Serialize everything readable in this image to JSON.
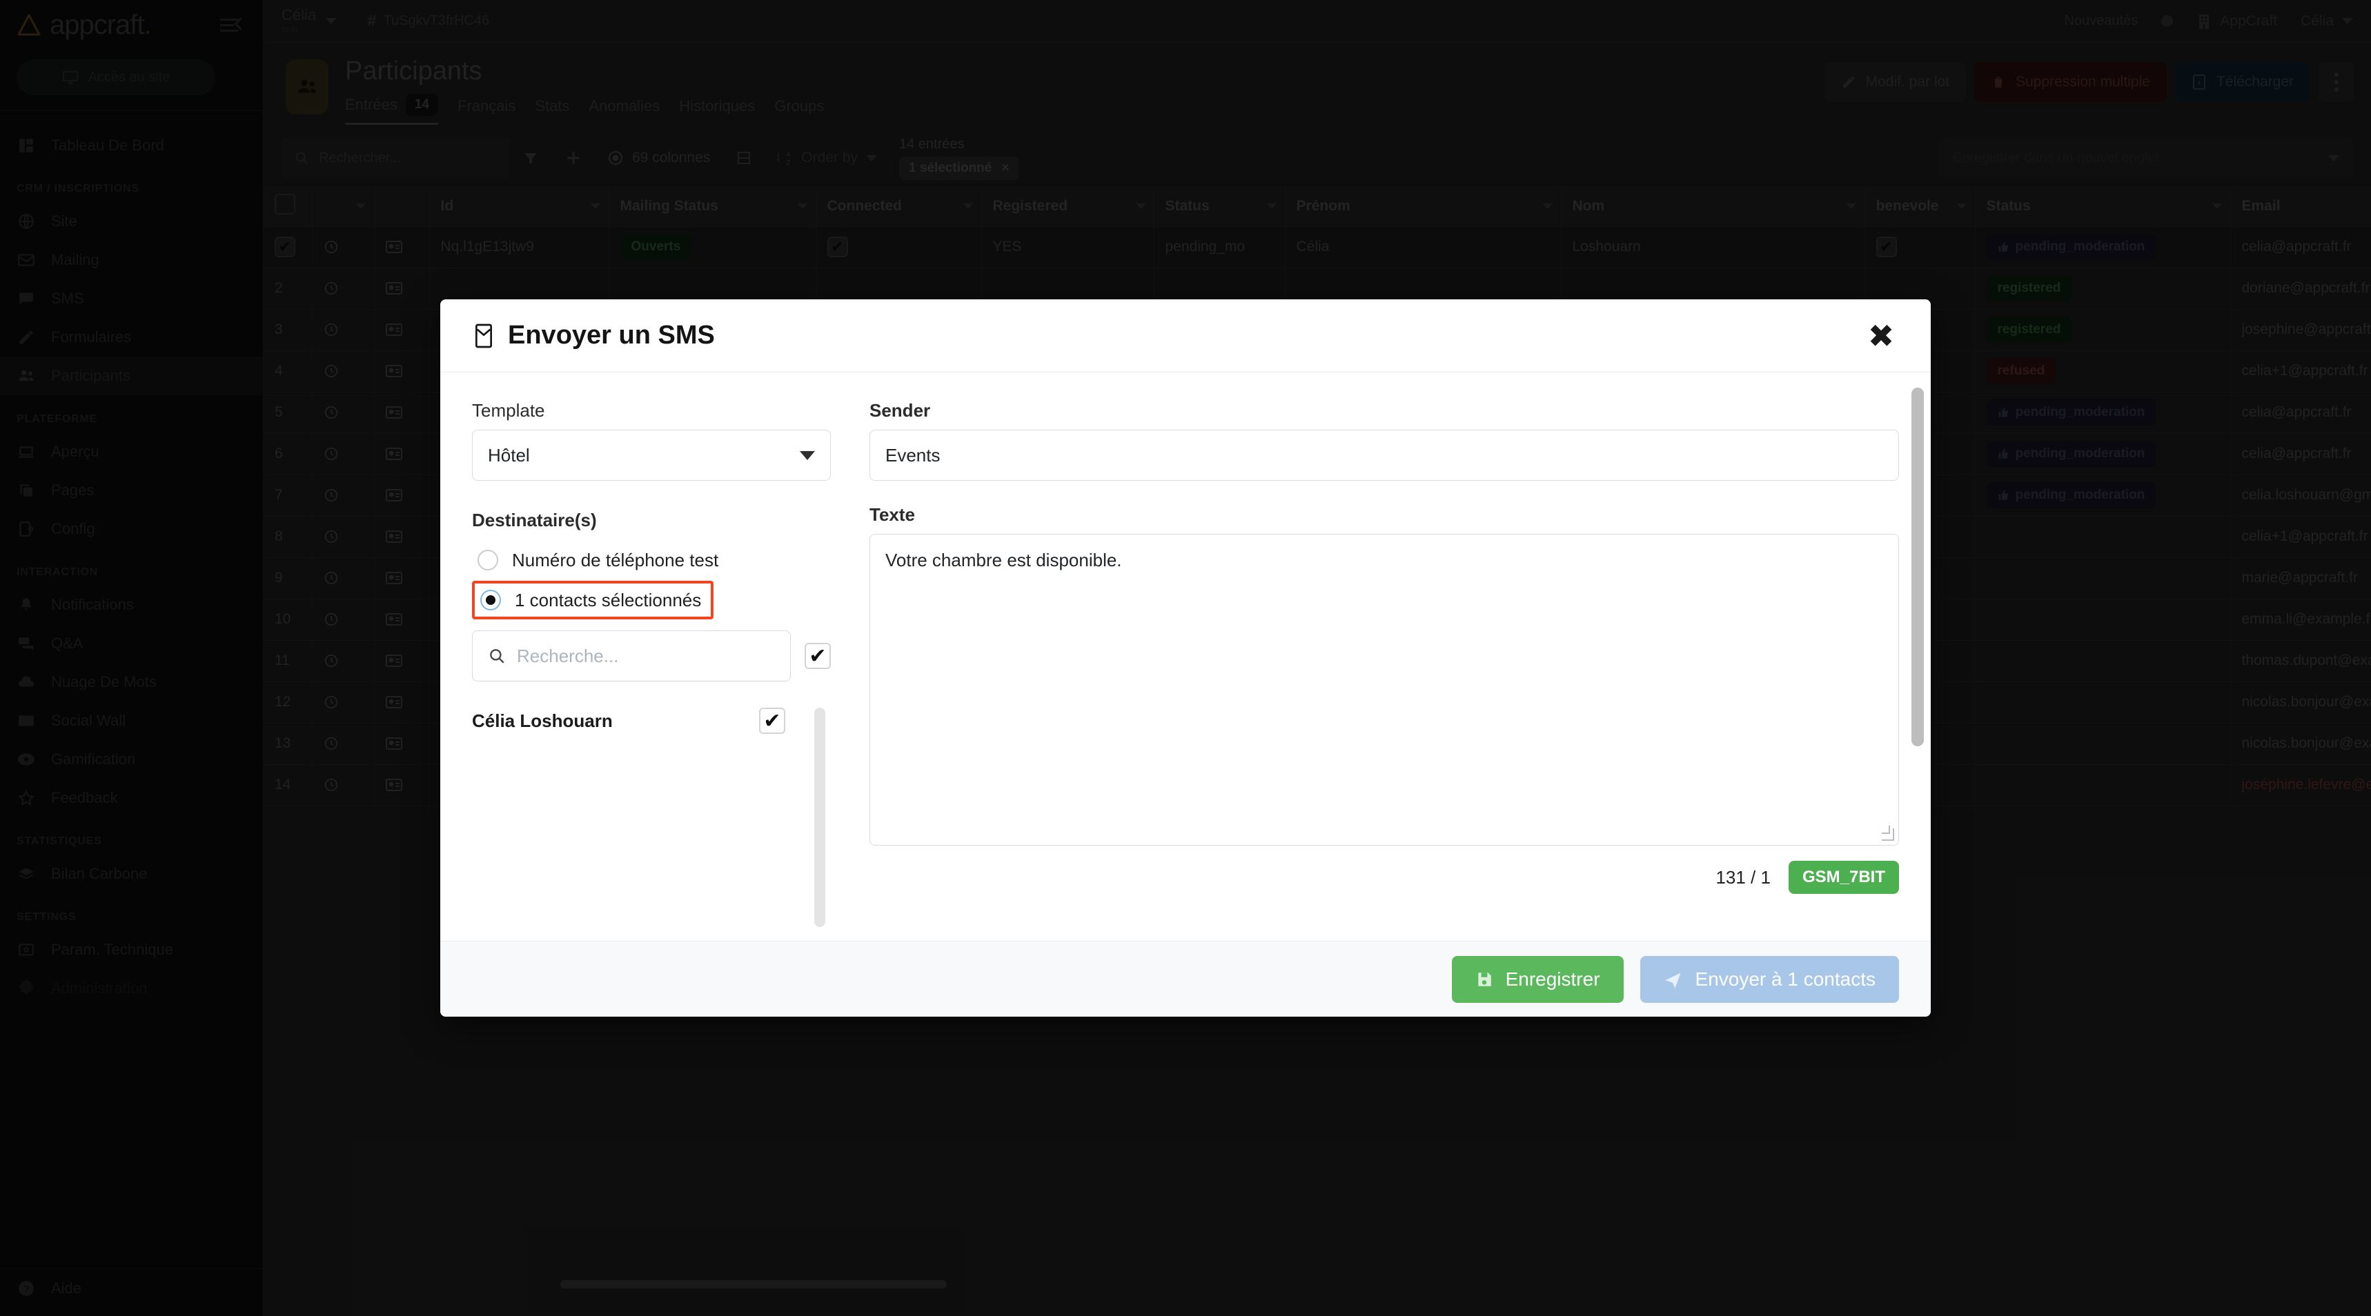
{
  "sidebar": {
    "brand": {
      "text": "appcraft",
      "dot": "."
    },
    "access_button": {
      "label": "Accès au site",
      "icon": "monitor-icon"
    },
    "sections": [
      {
        "title": "",
        "items": [
          {
            "label": "Tableau De Bord",
            "icon": "dashboard-icon",
            "active": false
          }
        ]
      },
      {
        "title": "CRM / INSCRIPTIONS",
        "items": [
          {
            "label": "Site",
            "icon": "globe-icon",
            "active": false
          },
          {
            "label": "Mailing",
            "icon": "envelope-icon",
            "active": false
          },
          {
            "label": "SMS",
            "icon": "chat-icon",
            "active": false
          },
          {
            "label": "Formulaires",
            "icon": "pencil-icon",
            "active": false
          },
          {
            "label": "Participants",
            "icon": "people-icon",
            "active": true
          }
        ]
      },
      {
        "title": "PLATEFORME",
        "items": [
          {
            "label": "Aperçu",
            "icon": "laptop-icon",
            "active": false
          },
          {
            "label": "Pages",
            "icon": "pages-icon",
            "active": false
          },
          {
            "label": "Config",
            "icon": "config-icon",
            "active": false
          }
        ]
      },
      {
        "title": "INTERACTION",
        "items": [
          {
            "label": "Notifications",
            "icon": "bell-icon",
            "active": false
          },
          {
            "label": "Q&A",
            "icon": "forum-icon",
            "active": false
          },
          {
            "label": "Nuage De Mots",
            "icon": "cloud-icon",
            "active": false
          },
          {
            "label": "Social Wall",
            "icon": "image-icon",
            "active": false
          },
          {
            "label": "Gamification",
            "icon": "star-badge-icon",
            "active": false
          },
          {
            "label": "Feedback",
            "icon": "star-icon",
            "active": false
          }
        ]
      },
      {
        "title": "STATISTIQUES",
        "items": [
          {
            "label": "Bilan Carbone",
            "icon": "layers-icon",
            "active": false
          }
        ]
      },
      {
        "title": "SETTINGS",
        "items": [
          {
            "label": "Param. Technique",
            "icon": "sliders-icon",
            "active": false
          },
          {
            "label": "Administration",
            "icon": "gear-icon",
            "active": false,
            "dim": true
          }
        ]
      }
    ],
    "footer": {
      "label": "Aide",
      "icon": "help-icon"
    }
  },
  "topbar": {
    "project_name": "Célia",
    "project_sub": "test",
    "hash_symbol": "#",
    "hash_code": "TuSgkvT3frHC46",
    "news_label": "Nouveautés",
    "org_label": "AppCraft",
    "user_label": "Célia"
  },
  "page_header": {
    "title": "Participants",
    "icon": "people-icon",
    "tabs": [
      {
        "label": "Entrées",
        "count": "14",
        "selected": true
      },
      {
        "label": "Français",
        "count": "",
        "selected": false
      },
      {
        "label": "Stats",
        "count": "",
        "selected": false
      },
      {
        "label": "Anomalies",
        "count": "",
        "selected": false
      },
      {
        "label": "Historiques",
        "count": "",
        "selected": false
      },
      {
        "label": "Groups",
        "count": "",
        "selected": false
      }
    ],
    "actions": [
      {
        "label": "Modif. par lot",
        "icon": "pencil-icon",
        "style": "ghost"
      },
      {
        "label": "Suppression multiple",
        "icon": "trash-icon",
        "style": "danger"
      },
      {
        "label": "Télécharger",
        "icon": "excel-icon",
        "style": "info"
      }
    ],
    "kebab": "more-vertical-icon"
  },
  "toolbar": {
    "search_placeholder": "Rechercher...",
    "search_value": "",
    "filter_icon": "funnel-icon",
    "add_icon": "plus-icon",
    "columns_label": "69 colonnes",
    "columns_icon": "eye-icon",
    "group_icon": "group-icon",
    "orderby_label": "Order by",
    "orderby_icon": "sort-az-icon",
    "entries_label": "14 entrées",
    "selected_chip": "1 sélectionné",
    "selected_chip_close": "×",
    "save_view_placeholder": "Enregistrer dans un nouvel onglet"
  },
  "table": {
    "columns": [
      "",
      "",
      "",
      "Id",
      "Mailing Status",
      "Connected",
      "Registered",
      "Status",
      "Prénom",
      "Nom",
      "benevole",
      "Status",
      "Email"
    ],
    "rows": [
      {
        "num": "1",
        "selected": true,
        "id": "Nq.l1gE13jtw9",
        "mailing": "Ouverts",
        "mailing_style": "green",
        "connected": "check",
        "registered": "YES",
        "status": "pending_mo",
        "prenom": "Célia",
        "nom": "Loshouarn",
        "benevole": "check",
        "status2": "pending_moderation",
        "status2_style": "dark",
        "email": "celia@appcraft.fr",
        "email_style": "normal"
      },
      {
        "num": "2",
        "selected": false,
        "id": "",
        "mailing": "",
        "mailing_style": "",
        "connected": "",
        "registered": "",
        "status": "",
        "prenom": "",
        "nom": "",
        "benevole": "",
        "status2": "registered",
        "status2_style": "green",
        "email": "doriane@appcraft.fr",
        "email_style": "normal"
      },
      {
        "num": "3",
        "selected": false,
        "id": "",
        "mailing": "",
        "mailing_style": "",
        "connected": "",
        "registered": "",
        "status": "",
        "prenom": "",
        "nom": "",
        "benevole": "",
        "status2": "registered",
        "status2_style": "green",
        "email": "josephine@appcraft.fr",
        "email_style": "normal"
      },
      {
        "num": "4",
        "selected": false,
        "id": "",
        "mailing": "",
        "mailing_style": "",
        "connected": "",
        "registered": "",
        "status": "",
        "prenom": "",
        "nom": "",
        "benevole": "",
        "status2": "refused",
        "status2_style": "red",
        "email": "celia+1@appcraft.fr",
        "email_style": "normal"
      },
      {
        "num": "5",
        "selected": false,
        "id": "",
        "mailing": "",
        "mailing_style": "",
        "connected": "",
        "registered": "",
        "status": "",
        "prenom": "",
        "nom": "",
        "benevole": "",
        "status2": "pending_moderation",
        "status2_style": "dark",
        "email": "celia@appcraft.fr",
        "email_style": "normal"
      },
      {
        "num": "6",
        "selected": false,
        "id": "",
        "mailing": "",
        "mailing_style": "",
        "connected": "",
        "registered": "",
        "status": "",
        "prenom": "",
        "nom": "",
        "benevole": "",
        "status2": "pending_moderation",
        "status2_style": "dark",
        "email": "celia@appcraft.fr",
        "email_style": "normal"
      },
      {
        "num": "7",
        "selected": false,
        "id": "",
        "mailing": "",
        "mailing_style": "",
        "connected": "",
        "registered": "",
        "status": "",
        "prenom": "",
        "nom": "",
        "benevole": "",
        "status2": "pending_moderation",
        "status2_style": "dark",
        "email": "celia.loshouarn@gmail.com",
        "email_style": "normal"
      },
      {
        "num": "8",
        "selected": false,
        "id": "",
        "mailing": "",
        "mailing_style": "",
        "connected": "",
        "registered": "",
        "status": "",
        "prenom": "",
        "nom": "",
        "benevole": "",
        "status2": "",
        "status2_style": "",
        "email": "celia+1@appcraft.fr",
        "email_style": "normal"
      },
      {
        "num": "9",
        "selected": false,
        "id": "",
        "mailing": "",
        "mailing_style": "",
        "connected": "",
        "registered": "",
        "status": "",
        "prenom": "",
        "nom": "",
        "benevole": "",
        "status2": "",
        "status2_style": "",
        "email": "marie@appcraft.fr",
        "email_style": "normal"
      },
      {
        "num": "10",
        "selected": false,
        "id": "",
        "mailing": "",
        "mailing_style": "",
        "connected": "",
        "registered": "",
        "status": "",
        "prenom": "",
        "nom": "",
        "benevole": "",
        "status2": "",
        "status2_style": "",
        "email": "emma.li@example.fr",
        "email_style": "normal"
      },
      {
        "num": "11",
        "selected": false,
        "id": "",
        "mailing": "",
        "mailing_style": "",
        "connected": "",
        "registered": "",
        "status": "",
        "prenom": "",
        "nom": "",
        "benevole": "",
        "status2": "",
        "status2_style": "",
        "email": "thomas.dupont@example.fr",
        "email_style": "normal"
      },
      {
        "num": "12",
        "selected": false,
        "id": "",
        "mailing": "",
        "mailing_style": "",
        "connected": "",
        "registered": "",
        "status": "",
        "prenom": "",
        "nom": "",
        "benevole": "",
        "status2": "",
        "status2_style": "",
        "email": "nicolas.bonjour@example.fr",
        "email_style": "normal"
      },
      {
        "num": "13",
        "selected": false,
        "id": "",
        "mailing": "",
        "mailing_style": "",
        "connected": "",
        "registered": "",
        "status": "",
        "prenom": "",
        "nom": "",
        "benevole": "",
        "status2": "",
        "status2_style": "",
        "email": "nicolas.bonjour@example.fr",
        "email_style": "normal"
      },
      {
        "num": "14",
        "selected": false,
        "id": "",
        "mailing": "",
        "mailing_style": "",
        "connected": "",
        "registered": "",
        "status": "",
        "prenom": "",
        "nom": "",
        "benevole": "",
        "status2": "",
        "status2_style": "",
        "email": "joséphine.lefevre@example",
        "email_style": "red"
      }
    ]
  },
  "modal": {
    "title": "Envoyer un SMS",
    "title_icon": "sms-icon",
    "close_icon": "close-icon",
    "template_label": "Template",
    "template_value": "Hôtel",
    "recipients_label": "Destinataire(s)",
    "radio_test": {
      "label": "Numéro de téléphone test",
      "selected": false
    },
    "radio_contacts": {
      "label": "1 contacts sélectionnés",
      "selected": true,
      "highlighted": true
    },
    "contact_search_placeholder": "Recherche...",
    "contact_search_value": "",
    "select_all_checked": true,
    "contacts": [
      {
        "name": "Célia Loshouarn",
        "checked": true
      }
    ],
    "sender_label": "Sender",
    "sender_value": "Events",
    "text_label": "Texte",
    "text_value": "Votre chambre est disponible.",
    "counter": "131 / 1",
    "encoding_badge": "GSM_7BIT",
    "save_button": {
      "label": "Enregistrer",
      "icon": "save-icon"
    },
    "send_button": {
      "label": "Envoyer à 1 contacts",
      "icon": "send-icon"
    }
  },
  "colors": {
    "accent_orange": "#f04722",
    "green": "#4caf50",
    "send_blue": "#a7c6e8",
    "sidebar_bg": "#0c0c0c",
    "page_bg": "#1e1e1e"
  }
}
